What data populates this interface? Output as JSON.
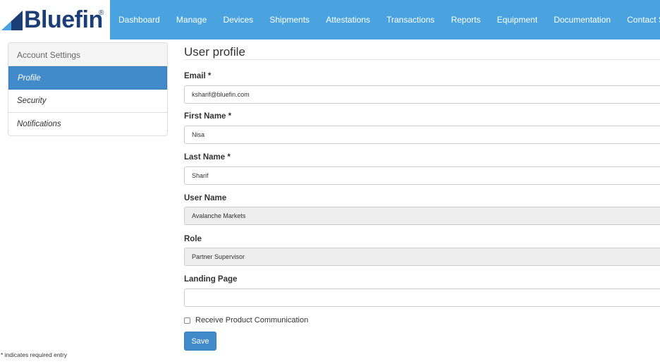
{
  "brand": {
    "name": "Bluefin",
    "registered_mark": "®"
  },
  "nav": {
    "items": [
      {
        "label": "Dashboard"
      },
      {
        "label": "Manage"
      },
      {
        "label": "Devices"
      },
      {
        "label": "Shipments"
      },
      {
        "label": "Attestations"
      },
      {
        "label": "Transactions"
      },
      {
        "label": "Reports"
      },
      {
        "label": "Equipment"
      },
      {
        "label": "Documentation"
      },
      {
        "label": "Contact Support"
      }
    ]
  },
  "sidebar": {
    "heading": "Account Settings",
    "items": [
      {
        "label": "Profile",
        "active": true
      },
      {
        "label": "Security",
        "active": false
      },
      {
        "label": "Notifications",
        "active": false
      }
    ]
  },
  "main": {
    "title": "User profile",
    "fields": {
      "email": {
        "label": "Email *",
        "value": "ksharif@bluefin.com"
      },
      "first_name": {
        "label": "First Name *",
        "value": "Nisa"
      },
      "last_name": {
        "label": "Last Name *",
        "value": "Sharif"
      },
      "user_name": {
        "label": "User Name",
        "value": "Avalanche Markets"
      },
      "role": {
        "label": "Role",
        "value": "Partner Supervisor"
      },
      "landing_page": {
        "label": "Landing Page",
        "value": ""
      }
    },
    "communication_checkbox": {
      "label": "Receive Product Communication",
      "checked": false
    },
    "save_label": "Save"
  },
  "footnote": "* indicates required entry",
  "colors": {
    "header_bg": "#4aa3df",
    "brand_text": "#1c3e77",
    "active_item_bg": "#428bca",
    "button_bg": "#428bca"
  }
}
